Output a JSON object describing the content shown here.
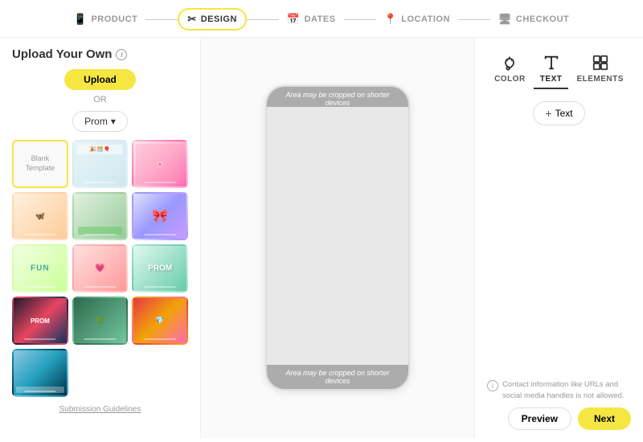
{
  "nav": {
    "steps": [
      {
        "id": "product",
        "label": "PRODUCT",
        "icon": "📱",
        "active": false
      },
      {
        "id": "design",
        "label": "DESIGN",
        "icon": "✂",
        "active": true
      },
      {
        "id": "dates",
        "label": "DATES",
        "icon": "📅",
        "active": false
      },
      {
        "id": "location",
        "label": "LOCATION",
        "icon": "📍",
        "active": false
      },
      {
        "id": "checkout",
        "label": "CHECKOUT",
        "icon": "🖥",
        "active": false
      }
    ]
  },
  "left": {
    "title": "Upload Your Own",
    "upload_button": "Upload",
    "or_text": "OR",
    "category": "Prom",
    "blank_template_label": "Blank\nTemplate",
    "submission_link": "Submission Guidelines"
  },
  "center": {
    "crop_warning_top": "Area may be cropped on shorter devices",
    "crop_warning_bottom": "Area may be cropped on shorter devices"
  },
  "right": {
    "tools": [
      {
        "id": "color",
        "label": "COLOR",
        "active": false
      },
      {
        "id": "text",
        "label": "TEXT",
        "active": true
      },
      {
        "id": "elements",
        "label": "ELEMENTS",
        "active": false
      }
    ],
    "add_text_button": "+ Text",
    "info_note": "Contact information like URLs and social media handles is not allowed.",
    "preview_button": "Preview",
    "next_button": "Next"
  }
}
